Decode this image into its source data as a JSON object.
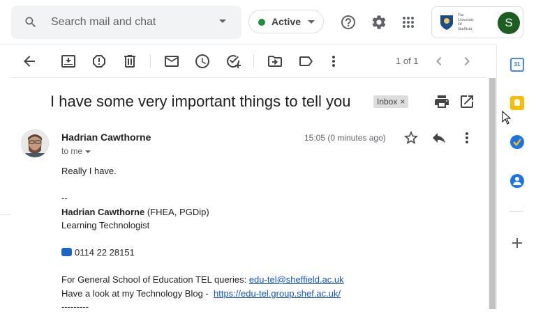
{
  "search": {
    "placeholder": "Search mail and chat"
  },
  "status": {
    "label": "Active",
    "color": "#1e8e3e"
  },
  "org": {
    "name_lines": [
      "The",
      "University",
      "Of",
      "Sheffield."
    ],
    "avatar_letter": "S"
  },
  "toolbar": {
    "icons": [
      "back-arrow-icon",
      "archive-icon",
      "report-spam-icon",
      "delete-icon",
      "mark-unread-icon",
      "snooze-icon",
      "add-to-tasks-icon",
      "move-to-icon",
      "label-icon",
      "more-vert-icon"
    ],
    "pager": "1 of 1"
  },
  "email": {
    "subject": "I have some very important things to tell you",
    "label_chip": "Inbox",
    "sender": "Hadrian Cawthorne",
    "to": "to me",
    "time": "15:05 (0 minutes ago)",
    "body": {
      "line1": "Really I have.",
      "sig_dash": "--",
      "sig_name": "Hadrian Cawthorne",
      "sig_quals": "(FHEA, PGDip)",
      "sig_role": "Learning Technologist",
      "phone": "0114 22 28151",
      "tel_prefix": "For General School of Education TEL queries: ",
      "tel_email": "edu-tel@sheffield.ac.uk",
      "blog_prefix": "Have a look at my Technology Blog -  ",
      "blog_url": "https://edu-tel.group.shef.ac.uk/",
      "dashes": "---------"
    }
  },
  "side_panel": {
    "apps": [
      "calendar-icon",
      "keep-icon",
      "tasks-icon",
      "contacts-icon",
      "add-icon"
    ],
    "calendar_day": "31"
  }
}
